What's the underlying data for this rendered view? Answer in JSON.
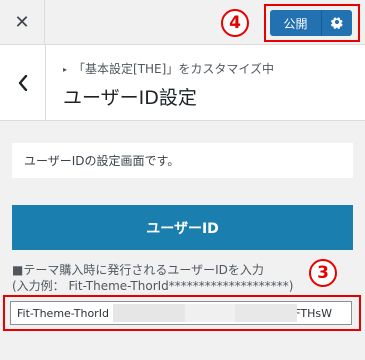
{
  "topbar": {
    "close_icon": "close-icon",
    "publish_label": "公開",
    "settings_icon": "gear-icon"
  },
  "annotations": {
    "badge_publish": "4",
    "badge_field": "3"
  },
  "header": {
    "back_icon": "chevron-left-icon",
    "breadcrumb": "「基本設定[THE]」をカスタマイズ中",
    "title": "ユーザーID設定"
  },
  "content": {
    "description": "ユーザーIDの設定画面です。",
    "user_id_button_label": "ユーザーID",
    "input_label_line1": "■テーマ購入時に発行されるユーザーIDを入力",
    "input_label_line2": "(入力例： Fit-Theme-ThorId********************)",
    "input_value": "Fit-Theme-ThorId                                                     FTHsW"
  },
  "colors": {
    "accent": "#2271b1",
    "button": "#1a7fae",
    "highlight": "#e60000"
  }
}
